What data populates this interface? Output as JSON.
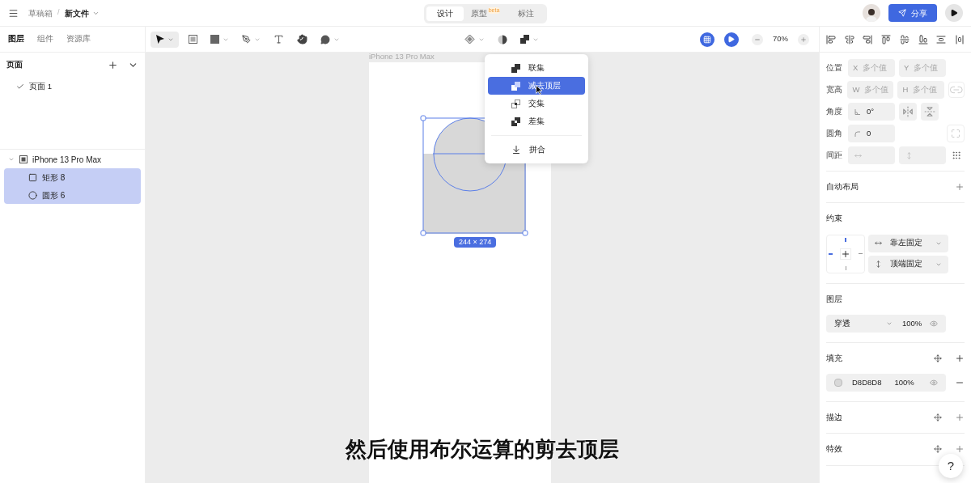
{
  "topbar": {
    "breadcrumb": "草稿箱",
    "separator": "/",
    "file_name": "新文件",
    "mode_tabs": [
      {
        "label": "设计",
        "selected": true
      },
      {
        "label": "原型",
        "badge": "beta",
        "selected": false
      },
      {
        "label": "标注",
        "selected": false
      }
    ],
    "share_button": "分享"
  },
  "left_panel": {
    "tabs": [
      {
        "label": "图层",
        "selected": true
      },
      {
        "label": "组件",
        "selected": false
      },
      {
        "label": "资源库",
        "selected": false
      }
    ],
    "pages_title": "页面",
    "pages": [
      {
        "label": "页面 1",
        "selected": true
      }
    ],
    "layers": [
      {
        "label": "iPhone 13 Pro Max",
        "kind": "frame",
        "expanded": true,
        "selected": false,
        "children": [
          {
            "label": "矩形 8",
            "kind": "rect",
            "selected": true
          },
          {
            "label": "圆形 6",
            "kind": "ellipse",
            "selected": true
          }
        ]
      }
    ]
  },
  "toolbar": {
    "zoom": "70%"
  },
  "canvas": {
    "frame_label": "iPhone 13 Pro Max",
    "size_label": "244 × 274",
    "subtitle": "然后使用布尔运算的剪去顶层"
  },
  "boolean_menu": {
    "items": [
      {
        "label": "联集",
        "kind": "union",
        "selected": false
      },
      {
        "label": "减去顶层",
        "kind": "subtract",
        "selected": true
      },
      {
        "label": "交集",
        "kind": "intersect",
        "selected": false
      },
      {
        "label": "差集",
        "kind": "exclude",
        "selected": false
      },
      {
        "label": "拼合",
        "kind": "flatten",
        "selected": false
      }
    ]
  },
  "right_panel": {
    "properties": [
      {
        "label": "位置",
        "fields": [
          {
            "prefix": "X",
            "placeholder": "多个值"
          },
          {
            "prefix": "Y",
            "placeholder": "多个值"
          }
        ]
      },
      {
        "label": "宽高",
        "fields": [
          {
            "prefix": "W",
            "placeholder": "多个值"
          },
          {
            "prefix": "H",
            "placeholder": "多个值"
          }
        ]
      },
      {
        "label": "角度",
        "fields": [
          {
            "value": "0°"
          }
        ]
      },
      {
        "label": "圆角",
        "fields": [
          {
            "value": "0"
          }
        ]
      },
      {
        "label": "间距"
      }
    ],
    "auto_layout": "自动布局",
    "constraints": {
      "title": "约束",
      "horizontal": "靠左固定",
      "vertical": "顶端固定"
    },
    "layer": {
      "title": "图层",
      "blend": "穿透",
      "opacity": "100%"
    },
    "fill": {
      "title": "填充",
      "color": "#d8d8d8",
      "hex": "D8D8D8",
      "opacity": "100%"
    },
    "stroke": "描边",
    "effects": "特效",
    "help": "?"
  }
}
